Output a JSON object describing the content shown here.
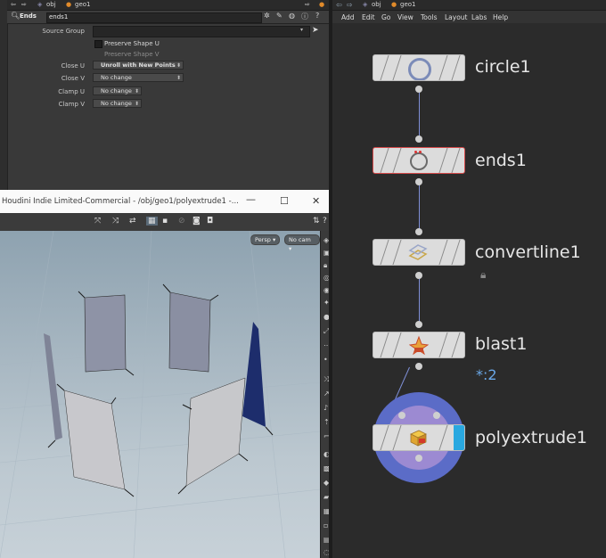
{
  "param_pane": {
    "path": {
      "ctx_label": "obj",
      "node_label": "geo1"
    },
    "header": {
      "op_type": "Ends",
      "op_name": "ends1"
    },
    "params": {
      "source_group_label": "Source Group",
      "source_group_value": "",
      "preserve_shape_u": "Preserve Shape U",
      "preserve_shape_v": "Preserve Shape V",
      "close_u_label": "Close U",
      "close_u_value": "Unroll with New Points",
      "close_v_label": "Close V",
      "close_v_value": "No change",
      "clamp_u_label": "Clamp U",
      "clamp_u_value": "No change",
      "clamp_v_label": "Clamp V",
      "clamp_v_value": "No change"
    }
  },
  "viewport": {
    "title": "Houdini Indie Limited-Commercial - /obj/geo1/polyextrude1 -...",
    "camera_persp": "Persp",
    "camera_nocam": "No cam",
    "bg_top": "#8ea2b0",
    "bg_bottom": "#c7d1d8"
  },
  "network": {
    "path": {
      "ctx_label": "obj",
      "node_label": "geo1"
    },
    "menu": [
      "Add",
      "Edit",
      "Go",
      "View",
      "Tools",
      "Layout",
      "Labs",
      "Help"
    ],
    "nodes": [
      {
        "name": "circle1",
        "icon": "circle-icon"
      },
      {
        "name": "ends1",
        "icon": "ends-circle-icon"
      },
      {
        "name": "convertline1",
        "icon": "convertline-icon"
      },
      {
        "name": "blast1",
        "icon": "blast-icon",
        "group_label": "*:2"
      },
      {
        "name": "polyextrude1",
        "icon": "polyextrude-icon"
      }
    ],
    "wire_color": "#7f8fd6",
    "display_flag_color": "#29a8e0",
    "selected_ring_color": "#5b6cc7"
  }
}
